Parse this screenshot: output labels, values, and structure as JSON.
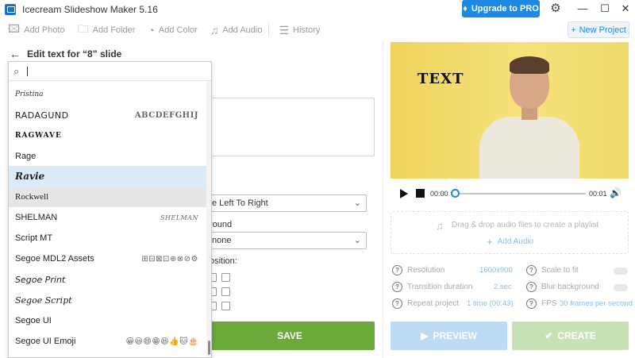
{
  "titlebar": {
    "title": "Icecream Slideshow Maker 5.16",
    "upgrade_label": "Upgrade to PRO",
    "minimize": "—",
    "maximize": "☐",
    "close": "✕"
  },
  "toolbar": {
    "items": [
      {
        "label": "Add Photo",
        "icon": "photo-icon"
      },
      {
        "label": "Add Folder",
        "icon": "folder-icon"
      },
      {
        "label": "Add Color",
        "icon": "palette-icon"
      },
      {
        "label": "Add Audio",
        "icon": "music-icon"
      },
      {
        "label": "History",
        "icon": "list-icon"
      }
    ],
    "new_project": "New Project"
  },
  "editor": {
    "header": "Edit text for “8” slide",
    "direction_value": "e Left To Right",
    "background_label": "round",
    "background_value": "none",
    "position_label": "osition:",
    "save_label": "SAVE"
  },
  "font_list": {
    "search_value": "",
    "items": [
      {
        "name": "Pristina",
        "preview": ""
      },
      {
        "name": "RADAGUND",
        "preview": "ABCDEFGHIJ"
      },
      {
        "name": "RAGWAVE",
        "preview": ""
      },
      {
        "name": "Rage",
        "preview": ""
      },
      {
        "name": "Ravie",
        "preview": ""
      },
      {
        "name": "Rockwell",
        "preview": ""
      },
      {
        "name": "SHELMAN",
        "preview": "SHELMAN"
      },
      {
        "name": "Script MT",
        "preview": ""
      },
      {
        "name": "Segoe MDL2 Assets",
        "preview": "⊞⊟⊠⊡⊕⊗⊘⚙"
      },
      {
        "name": "Segoe Print",
        "preview": ""
      },
      {
        "name": "Segoe Script",
        "preview": ""
      },
      {
        "name": "Segoe UI",
        "preview": ""
      },
      {
        "name": "Segoe UI Emoji",
        "preview": "😀😃😄😁😆👍🐱🎂"
      }
    ],
    "hover_index": 4,
    "selected_index": 5
  },
  "player": {
    "overlay_text": "TEXT",
    "current_time": "00:00",
    "total_time": "00:01"
  },
  "playlist": {
    "drop_text": "Drag & drop audio files to create a playlist",
    "add_audio": "Add Audio"
  },
  "settings": {
    "resolution_label": "Resolution",
    "resolution_value": "1600x900",
    "transition_label": "Transition duration",
    "transition_value": "2 sec",
    "repeat_label": "Repeat project",
    "repeat_value": "1 time (00:43)",
    "scale_label": "Scale to fit",
    "blur_label": "Blur background",
    "fps_label": "FPS",
    "fps_value": "30 frames per second"
  },
  "actions": {
    "preview": "PREVIEW",
    "create": "CREATE"
  }
}
